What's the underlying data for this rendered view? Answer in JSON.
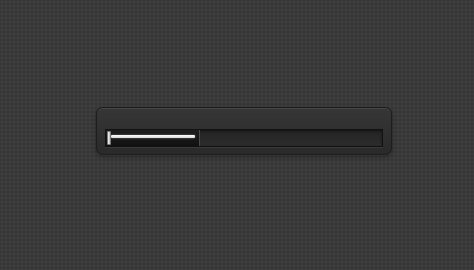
{
  "progress_panel": {
    "progress_fraction": 0.34,
    "colors": {
      "background": "#3a3a3a",
      "panel": "#2f2f2f",
      "track": "#282828",
      "fill_line": "#ffffff"
    },
    "icons": {
      "handle": "slider-handle-icon"
    }
  }
}
